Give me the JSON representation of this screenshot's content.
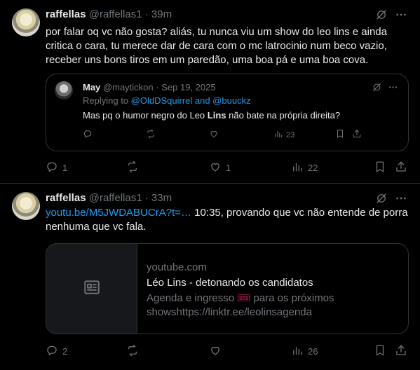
{
  "tweets": [
    {
      "author": "raffellas",
      "handle": "@raffellas1",
      "sep": "·",
      "time": "39m",
      "text": "por falar oq vc não gosta? aliás, tu nunca viu um show do leo lins e ainda critica o cara, tu merece dar de cara com o mc latrocinio num beco vazio, receber uns bons tiros em um paredão, uma boa pá e uma boa cova.",
      "quote": {
        "author": "May",
        "handle": "@maytickon",
        "sep": "·",
        "date": "Sep 19, 2025",
        "replying_prefix": "Replying to ",
        "replying_to": "@OldDSquirrel and @buuckz",
        "text_before": "Mas pq o humor negro do Leo ",
        "text_bold": "Lins",
        "text_after": " não bate na própria direita?",
        "views": "23"
      },
      "replies": "1",
      "reposts": "",
      "likes": "1",
      "views": "22"
    },
    {
      "author": "raffellas",
      "handle": "@raffellas1",
      "sep": "·",
      "time": "33m",
      "link": "youtu.be/M5JWDABUCrA?t=…",
      "text": " 10:35, provando que vc não entende de porra nenhuma que vc fala.",
      "card": {
        "domain": "youtube.com",
        "title": "Léo Lins - detonando os candidatos",
        "desc_before": "Agenda e ingresso ",
        "ticket": "🎟",
        "desc_after": " para os próximos showshttps://linktr.ee/leolinsagenda"
      },
      "replies": "2",
      "reposts": "",
      "likes": "",
      "views": "26"
    }
  ],
  "icons": {
    "grok": "grok-icon",
    "more": "more-icon",
    "reply": "reply-icon",
    "repost": "repost-icon",
    "like": "like-icon",
    "views": "views-icon",
    "bookmark": "bookmark-icon",
    "share": "share-icon",
    "article": "article-icon"
  },
  "colors": {
    "background": "#000000",
    "text": "#e7e9ea",
    "muted": "#71767b",
    "link": "#1d9bf0",
    "border": "#2f3336"
  }
}
